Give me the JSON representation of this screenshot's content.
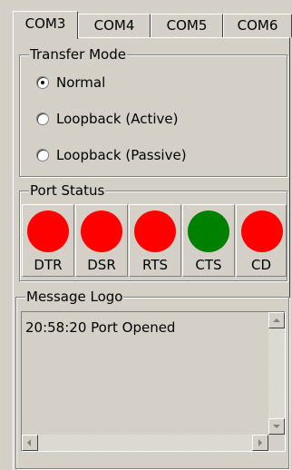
{
  "tabs": [
    {
      "label": "COM3",
      "active": true
    },
    {
      "label": "COM4",
      "active": false
    },
    {
      "label": "COM5",
      "active": false
    },
    {
      "label": "COM6",
      "active": false
    }
  ],
  "transfer_mode": {
    "title": "Transfer Mode",
    "options": [
      {
        "label": "Normal",
        "selected": true
      },
      {
        "label": "Loopback (Active)",
        "selected": false
      },
      {
        "label": "Loopback (Passive)",
        "selected": false
      }
    ]
  },
  "port_status": {
    "title": "Port Status",
    "signals": [
      {
        "label": "DTR",
        "state": "off",
        "color": "#ff0000"
      },
      {
        "label": "DSR",
        "state": "off",
        "color": "#ff0000"
      },
      {
        "label": "RTS",
        "state": "off",
        "color": "#ff0000"
      },
      {
        "label": "CTS",
        "state": "on",
        "color": "#008000"
      },
      {
        "label": "CD",
        "state": "off",
        "color": "#ff0000"
      }
    ]
  },
  "message_log": {
    "title": "Message Logo",
    "lines": [
      "20:58:20  Port Opened"
    ]
  }
}
